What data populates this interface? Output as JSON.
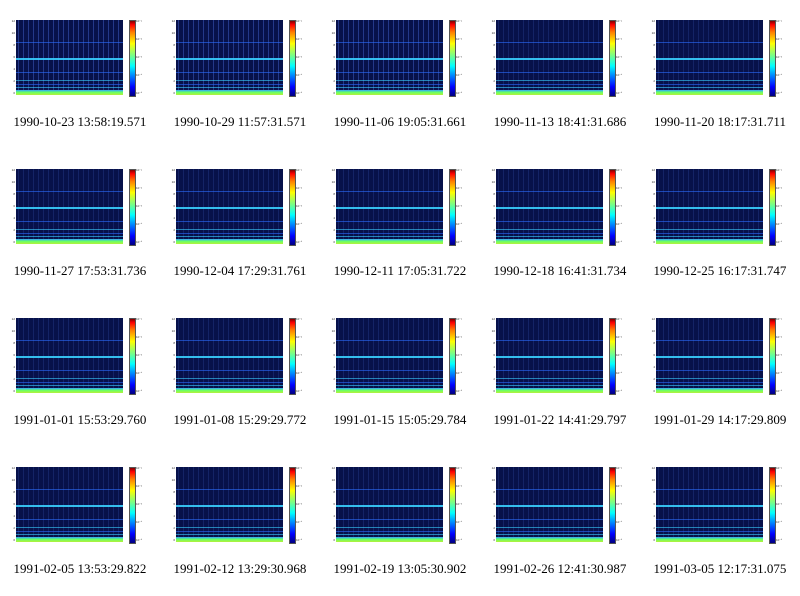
{
  "panels": [
    {
      "caption": "1990-10-23 13:58:19.571"
    },
    {
      "caption": "1990-10-29 11:57:31.571"
    },
    {
      "caption": "1990-11-06 19:05:31.661"
    },
    {
      "caption": "1990-11-13 18:41:31.686"
    },
    {
      "caption": "1990-11-20 18:17:31.711"
    },
    {
      "caption": "1990-11-27 17:53:31.736"
    },
    {
      "caption": "1990-12-04 17:29:31.761"
    },
    {
      "caption": "1990-12-11 17:05:31.722"
    },
    {
      "caption": "1990-12-18 16:41:31.734"
    },
    {
      "caption": "1990-12-25 16:17:31.747"
    },
    {
      "caption": "1991-01-01 15:53:29.760"
    },
    {
      "caption": "1991-01-08 15:29:29.772"
    },
    {
      "caption": "1991-01-15 15:05:29.784"
    },
    {
      "caption": "1991-01-22 14:41:29.797"
    },
    {
      "caption": "1991-01-29 14:17:29.809"
    },
    {
      "caption": "1991-02-05 13:53:29.822"
    },
    {
      "caption": "1991-02-12 13:29:30.968"
    },
    {
      "caption": "1991-02-19 13:05:30.902"
    },
    {
      "caption": "1991-02-26 12:41:30.987"
    },
    {
      "caption": "1991-03-05 12:17:31.075"
    }
  ],
  "colors": {
    "background_dark_blue": "#07114a",
    "band_cyan": "#3ad0ff",
    "band_blue": "#2b6cff",
    "floor_green": "#8cf03c"
  }
}
